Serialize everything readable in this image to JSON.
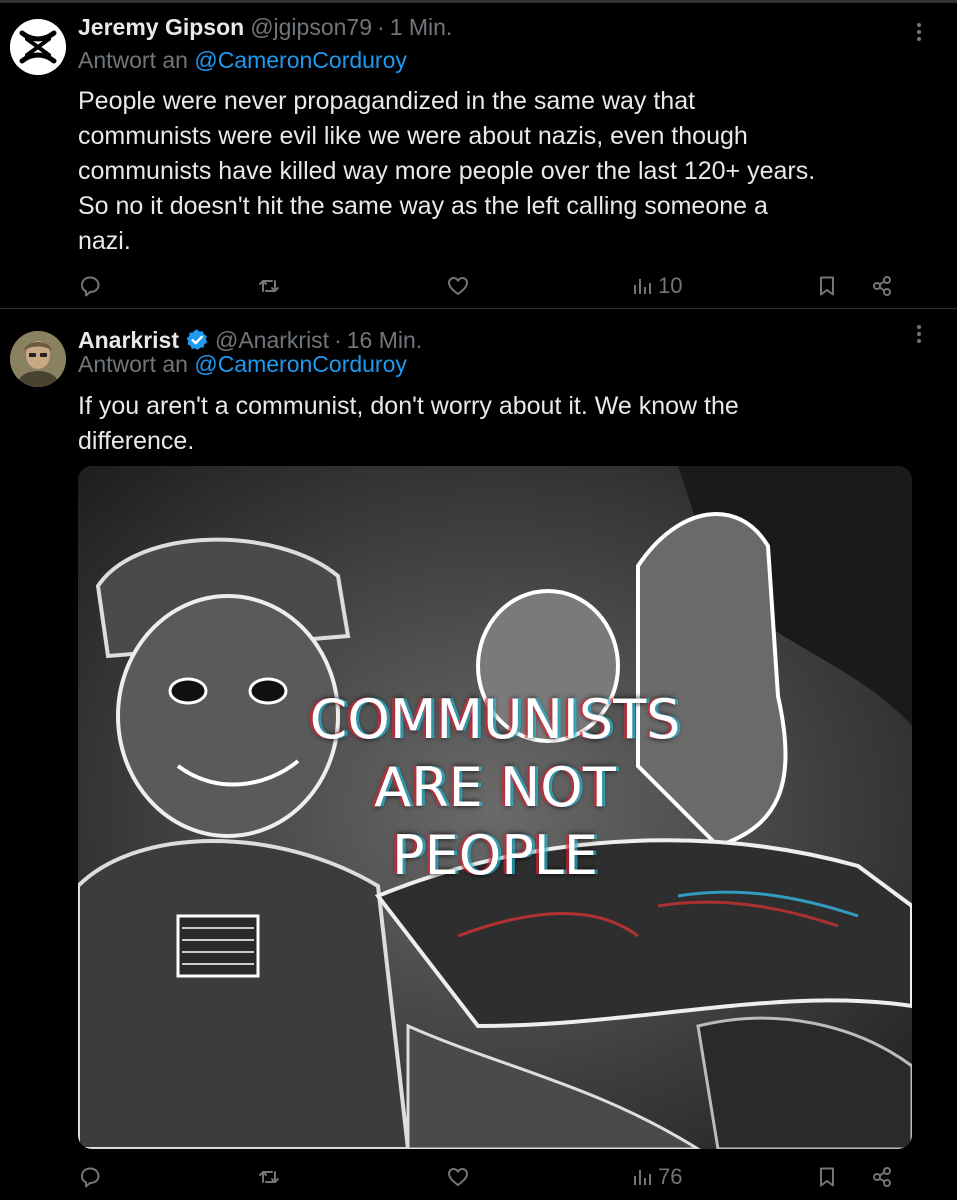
{
  "tweets": [
    {
      "display_name": "Jeremy Gipson",
      "handle": "@jgipson79",
      "separator": "·",
      "time": "1 Min.",
      "verified": false,
      "reply_prefix": "Antwort an",
      "reply_mention": "@CameronCorduroy",
      "text_lines": [
        "People were never propagandized in the same way that",
        "communists were evil like we were about nazis, even though",
        "communists  have killed way more people over the last 120+ years.",
        "So no it doesn't hit the same way as the left calling someone a",
        "nazi."
      ],
      "views": "10",
      "avatar_icon": "x-logo-avatar-icon"
    },
    {
      "display_name": "Anarkrist",
      "handle": "@Anarkrist",
      "separator": "·",
      "time": "16 Min.",
      "verified": true,
      "reply_prefix": "Antwort an",
      "reply_mention": "@CameronCorduroy",
      "text_lines": [
        "If you aren't a communist, don't worry about it. We know the",
        "difference."
      ],
      "media": {
        "caption_lines": [
          "COMMUNISTS",
          "ARE NOT",
          "PEOPLE"
        ]
      },
      "views": "76",
      "avatar_icon": "profile-photo-avatar-icon"
    }
  ],
  "colors": {
    "background": "#000000",
    "text_primary": "#e7e9ea",
    "text_secondary": "#71767b",
    "link": "#1d9bf0",
    "divider": "#2f3336",
    "verified_badge": "#1d9bf0"
  },
  "icons": {
    "reply": "reply-icon",
    "repost": "repost-icon",
    "like": "heart-icon",
    "views": "views-chart-icon",
    "bookmark": "bookmark-icon",
    "share": "share-icon",
    "more": "more-dots-icon",
    "verified": "verified-badge-icon"
  }
}
